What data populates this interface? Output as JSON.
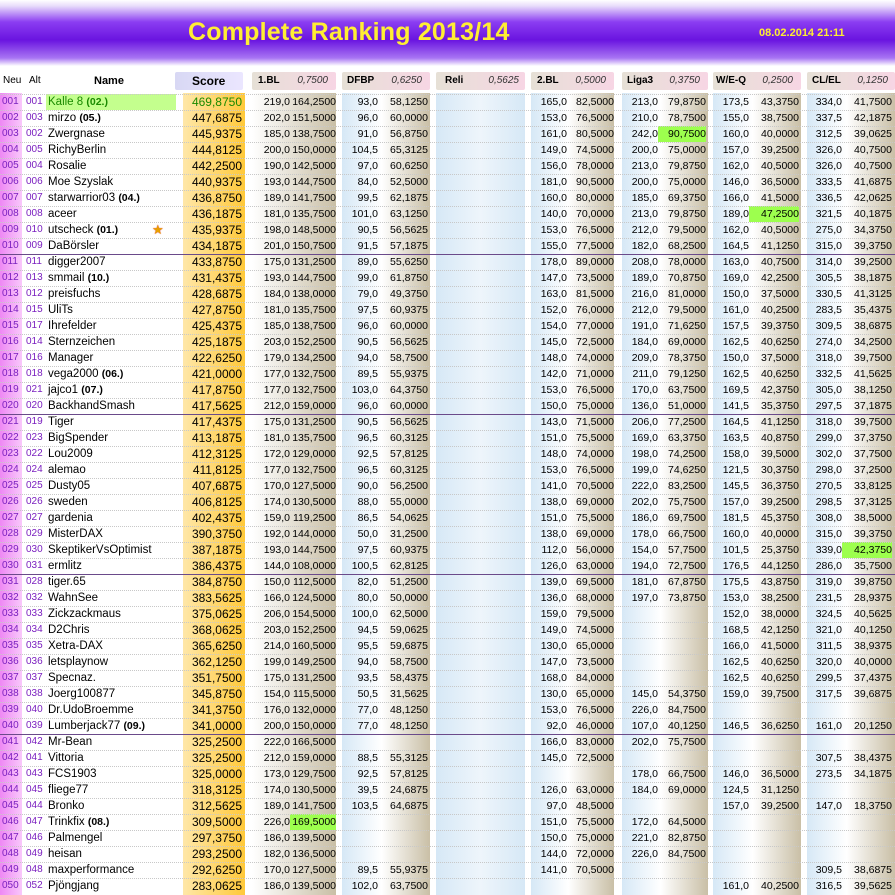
{
  "title": "Complete Ranking 2013/14",
  "date": "08.02.2014 21:11",
  "headers": {
    "neu": "Neu",
    "alt": "Alt",
    "name": "Name",
    "score": "Score",
    "bl1": "1.BL",
    "bl1_w": "0,7500",
    "dfbp": "DFBP",
    "dfbp_w": "0,6250",
    "reli": "Reli",
    "reli_w": "0,5625",
    "bl2": "2.BL",
    "bl2_w": "0,5000",
    "liga3": "Liga3",
    "liga3_w": "0,3750",
    "weq": "W/E-Q",
    "weq_w": "0,2500",
    "clel": "CL/EL",
    "clel_w": "0,1250"
  },
  "colors": {
    "accent": "#8b3df2",
    "title": "#ffee33",
    "rank": "#7a1fbf",
    "highlight": "#9dff4e",
    "leader": "#c4ff8e"
  },
  "rows": [
    {
      "neu": "001",
      "alt": "001",
      "name": "Kalle 8",
      "tag": "(02.)",
      "score": "469,8750",
      "c": [
        "219,0",
        "164,2500",
        "93,0",
        "58,1250",
        "",
        "",
        "165,0",
        "82,5000",
        "213,0",
        "79,8750",
        "173,5",
        "43,3750",
        "334,0",
        "41,7500"
      ]
    },
    {
      "neu": "002",
      "alt": "003",
      "name": "mirzo",
      "tag": "(05.)",
      "score": "447,6875",
      "c": [
        "202,0",
        "151,5000",
        "96,0",
        "60,0000",
        "",
        "",
        "153,0",
        "76,5000",
        "210,0",
        "78,7500",
        "155,0",
        "38,7500",
        "337,5",
        "42,1875"
      ]
    },
    {
      "neu": "003",
      "alt": "002",
      "name": "Zwergnase",
      "tag": "",
      "score": "445,9375",
      "c": [
        "185,0",
        "138,7500",
        "91,0",
        "56,8750",
        "",
        "",
        "161,0",
        "80,5000",
        "242,0",
        "90,7500",
        "160,0",
        "40,0000",
        "312,5",
        "39,0625"
      ]
    },
    {
      "neu": "004",
      "alt": "005",
      "name": "RichyBerlin",
      "tag": "",
      "score": "444,8125",
      "c": [
        "200,0",
        "150,0000",
        "104,5",
        "65,3125",
        "",
        "",
        "149,0",
        "74,5000",
        "200,0",
        "75,0000",
        "157,0",
        "39,2500",
        "326,0",
        "40,7500"
      ]
    },
    {
      "neu": "005",
      "alt": "004",
      "name": "Rosalie",
      "tag": "",
      "score": "442,2500",
      "c": [
        "190,0",
        "142,5000",
        "97,0",
        "60,6250",
        "",
        "",
        "156,0",
        "78,0000",
        "213,0",
        "79,8750",
        "162,0",
        "40,5000",
        "326,0",
        "40,7500"
      ]
    },
    {
      "neu": "006",
      "alt": "006",
      "name": "Moe Szyslak",
      "tag": "",
      "score": "440,9375",
      "c": [
        "193,0",
        "144,7500",
        "84,0",
        "52,5000",
        "",
        "",
        "181,0",
        "90,5000",
        "200,0",
        "75,0000",
        "146,0",
        "36,5000",
        "333,5",
        "41,6875"
      ]
    },
    {
      "neu": "007",
      "alt": "007",
      "name": "starwarrior03",
      "tag": "(04.)",
      "score": "436,8750",
      "c": [
        "189,0",
        "141,7500",
        "99,5",
        "62,1875",
        "",
        "",
        "160,0",
        "80,0000",
        "185,0",
        "69,3750",
        "166,0",
        "41,5000",
        "336,5",
        "42,0625"
      ]
    },
    {
      "neu": "008",
      "alt": "008",
      "name": "aceer",
      "tag": "",
      "score": "436,1875",
      "c": [
        "181,0",
        "135,7500",
        "101,0",
        "63,1250",
        "",
        "",
        "140,0",
        "70,0000",
        "213,0",
        "79,8750",
        "189,0",
        "47,2500",
        "321,5",
        "40,1875"
      ]
    },
    {
      "neu": "009",
      "alt": "010",
      "name": "utscheck",
      "tag": "(01.)",
      "star": "★",
      "score": "435,9375",
      "c": [
        "198,0",
        "148,5000",
        "90,5",
        "56,5625",
        "",
        "",
        "153,0",
        "76,5000",
        "212,0",
        "79,5000",
        "162,0",
        "40,5000",
        "275,0",
        "34,3750"
      ]
    },
    {
      "neu": "010",
      "alt": "009",
      "name": "DaBörsler",
      "tag": "",
      "score": "434,1875",
      "c": [
        "201,0",
        "150,7500",
        "91,5",
        "57,1875",
        "",
        "",
        "155,0",
        "77,5000",
        "182,0",
        "68,2500",
        "164,5",
        "41,1250",
        "315,0",
        "39,3750"
      ]
    },
    {
      "neu": "011",
      "alt": "011",
      "name": "digger2007",
      "tag": "",
      "score": "433,8750",
      "c": [
        "175,0",
        "131,2500",
        "89,0",
        "55,6250",
        "",
        "",
        "178,0",
        "89,0000",
        "208,0",
        "78,0000",
        "163,0",
        "40,7500",
        "314,0",
        "39,2500"
      ]
    },
    {
      "neu": "012",
      "alt": "013",
      "name": "smmail",
      "tag": "(10.)",
      "score": "431,4375",
      "c": [
        "193,0",
        "144,7500",
        "99,0",
        "61,8750",
        "",
        "",
        "147,0",
        "73,5000",
        "189,0",
        "70,8750",
        "169,0",
        "42,2500",
        "305,5",
        "38,1875"
      ]
    },
    {
      "neu": "013",
      "alt": "012",
      "name": "preisfuchs",
      "tag": "",
      "score": "428,6875",
      "c": [
        "184,0",
        "138,0000",
        "79,0",
        "49,3750",
        "",
        "",
        "163,0",
        "81,5000",
        "216,0",
        "81,0000",
        "150,0",
        "37,5000",
        "330,5",
        "41,3125"
      ]
    },
    {
      "neu": "014",
      "alt": "015",
      "name": "UliTs",
      "tag": "",
      "score": "427,8750",
      "c": [
        "181,0",
        "135,7500",
        "97,5",
        "60,9375",
        "",
        "",
        "152,0",
        "76,0000",
        "212,0",
        "79,5000",
        "161,0",
        "40,2500",
        "283,5",
        "35,4375"
      ]
    },
    {
      "neu": "015",
      "alt": "017",
      "name": "Ihrefelder",
      "tag": "",
      "score": "425,4375",
      "c": [
        "185,0",
        "138,7500",
        "96,0",
        "60,0000",
        "",
        "",
        "154,0",
        "77,0000",
        "191,0",
        "71,6250",
        "157,5",
        "39,3750",
        "309,5",
        "38,6875"
      ]
    },
    {
      "neu": "016",
      "alt": "014",
      "name": "Sternzeichen",
      "tag": "",
      "score": "425,1875",
      "c": [
        "203,0",
        "152,2500",
        "90,5",
        "56,5625",
        "",
        "",
        "145,0",
        "72,5000",
        "184,0",
        "69,0000",
        "162,5",
        "40,6250",
        "274,0",
        "34,2500"
      ]
    },
    {
      "neu": "017",
      "alt": "016",
      "name": "Manager",
      "tag": "",
      "score": "422,6250",
      "c": [
        "179,0",
        "134,2500",
        "94,0",
        "58,7500",
        "",
        "",
        "148,0",
        "74,0000",
        "209,0",
        "78,3750",
        "150,0",
        "37,5000",
        "318,0",
        "39,7500"
      ]
    },
    {
      "neu": "018",
      "alt": "018",
      "name": "vega2000",
      "tag": "(06.)",
      "score": "421,0000",
      "c": [
        "177,0",
        "132,7500",
        "89,5",
        "55,9375",
        "",
        "",
        "142,0",
        "71,0000",
        "211,0",
        "79,1250",
        "162,5",
        "40,6250",
        "332,5",
        "41,5625"
      ]
    },
    {
      "neu": "019",
      "alt": "021",
      "name": "jajco1",
      "tag": "(07.)",
      "score": "417,8750",
      "c": [
        "177,0",
        "132,7500",
        "103,0",
        "64,3750",
        "",
        "",
        "153,0",
        "76,5000",
        "170,0",
        "63,7500",
        "169,5",
        "42,3750",
        "305,0",
        "38,1250"
      ]
    },
    {
      "neu": "020",
      "alt": "020",
      "name": "BackhandSmash",
      "tag": "",
      "score": "417,5625",
      "c": [
        "212,0",
        "159,0000",
        "96,0",
        "60,0000",
        "",
        "",
        "150,0",
        "75,0000",
        "136,0",
        "51,0000",
        "141,5",
        "35,3750",
        "297,5",
        "37,1875"
      ]
    },
    {
      "neu": "021",
      "alt": "019",
      "name": "Tiger",
      "tag": "",
      "score": "417,4375",
      "c": [
        "175,0",
        "131,2500",
        "90,5",
        "56,5625",
        "",
        "",
        "143,0",
        "71,5000",
        "206,0",
        "77,2500",
        "164,5",
        "41,1250",
        "318,0",
        "39,7500"
      ]
    },
    {
      "neu": "022",
      "alt": "023",
      "name": "BigSpender",
      "tag": "",
      "score": "413,1875",
      "c": [
        "181,0",
        "135,7500",
        "96,5",
        "60,3125",
        "",
        "",
        "151,0",
        "75,5000",
        "169,0",
        "63,3750",
        "163,5",
        "40,8750",
        "299,0",
        "37,3750"
      ]
    },
    {
      "neu": "023",
      "alt": "022",
      "name": "Lou2009",
      "tag": "",
      "score": "412,3125",
      "c": [
        "172,0",
        "129,0000",
        "92,5",
        "57,8125",
        "",
        "",
        "148,0",
        "74,0000",
        "198,0",
        "74,2500",
        "158,0",
        "39,5000",
        "302,0",
        "37,7500"
      ]
    },
    {
      "neu": "024",
      "alt": "024",
      "name": "alemao",
      "tag": "",
      "score": "411,8125",
      "c": [
        "177,0",
        "132,7500",
        "96,5",
        "60,3125",
        "",
        "",
        "153,0",
        "76,5000",
        "199,0",
        "74,6250",
        "121,5",
        "30,3750",
        "298,0",
        "37,2500"
      ]
    },
    {
      "neu": "025",
      "alt": "025",
      "name": "Dusty05",
      "tag": "",
      "score": "407,6875",
      "c": [
        "170,0",
        "127,5000",
        "90,0",
        "56,2500",
        "",
        "",
        "141,0",
        "70,5000",
        "222,0",
        "83,2500",
        "145,5",
        "36,3750",
        "270,5",
        "33,8125"
      ]
    },
    {
      "neu": "026",
      "alt": "026",
      "name": "sweden",
      "tag": "",
      "score": "406,8125",
      "c": [
        "174,0",
        "130,5000",
        "88,0",
        "55,0000",
        "",
        "",
        "138,0",
        "69,0000",
        "202,0",
        "75,7500",
        "157,0",
        "39,2500",
        "298,5",
        "37,3125"
      ]
    },
    {
      "neu": "027",
      "alt": "027",
      "name": "gardenia",
      "tag": "",
      "score": "402,4375",
      "c": [
        "159,0",
        "119,2500",
        "86,5",
        "54,0625",
        "",
        "",
        "151,0",
        "75,5000",
        "186,0",
        "69,7500",
        "181,5",
        "45,3750",
        "308,0",
        "38,5000"
      ]
    },
    {
      "neu": "028",
      "alt": "029",
      "name": "MisterDAX",
      "tag": "",
      "score": "390,3750",
      "c": [
        "192,0",
        "144,0000",
        "50,0",
        "31,2500",
        "",
        "",
        "138,0",
        "69,0000",
        "178,0",
        "66,7500",
        "160,0",
        "40,0000",
        "315,0",
        "39,3750"
      ]
    },
    {
      "neu": "029",
      "alt": "030",
      "name": "SkeptikerVsOptimist",
      "tag": "",
      "score": "387,1875",
      "c": [
        "193,0",
        "144,7500",
        "97,5",
        "60,9375",
        "",
        "",
        "112,0",
        "56,0000",
        "154,0",
        "57,7500",
        "101,5",
        "25,3750",
        "339,0",
        "42,3750"
      ]
    },
    {
      "neu": "030",
      "alt": "031",
      "name": "ermlitz",
      "tag": "",
      "score": "386,4375",
      "c": [
        "144,0",
        "108,0000",
        "100,5",
        "62,8125",
        "",
        "",
        "126,0",
        "63,0000",
        "194,0",
        "72,7500",
        "176,5",
        "44,1250",
        "286,0",
        "35,7500"
      ]
    },
    {
      "neu": "031",
      "alt": "028",
      "name": "tiger.65",
      "tag": "",
      "score": "384,8750",
      "c": [
        "150,0",
        "112,5000",
        "82,0",
        "51,2500",
        "",
        "",
        "139,0",
        "69,5000",
        "181,0",
        "67,8750",
        "175,5",
        "43,8750",
        "319,0",
        "39,8750"
      ]
    },
    {
      "neu": "032",
      "alt": "032",
      "name": "WahnSee",
      "tag": "",
      "score": "383,5625",
      "c": [
        "166,0",
        "124,5000",
        "80,0",
        "50,0000",
        "",
        "",
        "136,0",
        "68,0000",
        "197,0",
        "73,8750",
        "153,0",
        "38,2500",
        "231,5",
        "28,9375"
      ]
    },
    {
      "neu": "033",
      "alt": "033",
      "name": "Zickzackmaus",
      "tag": "",
      "score": "375,0625",
      "c": [
        "206,0",
        "154,5000",
        "100,0",
        "62,5000",
        "",
        "",
        "159,0",
        "79,5000",
        "",
        "",
        "152,0",
        "38,0000",
        "324,5",
        "40,5625"
      ]
    },
    {
      "neu": "034",
      "alt": "034",
      "name": "D2Chris",
      "tag": "",
      "score": "368,0625",
      "c": [
        "203,0",
        "152,2500",
        "94,5",
        "59,0625",
        "",
        "",
        "149,0",
        "74,5000",
        "",
        "",
        "168,5",
        "42,1250",
        "321,0",
        "40,1250"
      ]
    },
    {
      "neu": "035",
      "alt": "035",
      "name": "Xetra-DAX",
      "tag": "",
      "score": "365,6250",
      "c": [
        "214,0",
        "160,5000",
        "95,5",
        "59,6875",
        "",
        "",
        "130,0",
        "65,0000",
        "",
        "",
        "166,0",
        "41,5000",
        "311,5",
        "38,9375"
      ]
    },
    {
      "neu": "036",
      "alt": "036",
      "name": "letsplaynow",
      "tag": "",
      "score": "362,1250",
      "c": [
        "199,0",
        "149,2500",
        "94,0",
        "58,7500",
        "",
        "",
        "147,0",
        "73,5000",
        "",
        "",
        "162,5",
        "40,6250",
        "320,0",
        "40,0000"
      ]
    },
    {
      "neu": "037",
      "alt": "037",
      "name": "Specnaz.",
      "tag": "",
      "score": "351,7500",
      "c": [
        "175,0",
        "131,2500",
        "93,5",
        "58,4375",
        "",
        "",
        "168,0",
        "84,0000",
        "",
        "",
        "162,5",
        "40,6250",
        "299,5",
        "37,4375"
      ]
    },
    {
      "neu": "038",
      "alt": "038",
      "name": "Joerg100877",
      "tag": "",
      "score": "345,8750",
      "c": [
        "154,0",
        "115,5000",
        "50,5",
        "31,5625",
        "",
        "",
        "130,0",
        "65,0000",
        "145,0",
        "54,3750",
        "159,0",
        "39,7500",
        "317,5",
        "39,6875"
      ]
    },
    {
      "neu": "039",
      "alt": "040",
      "name": "Dr.UdoBroemme",
      "tag": "",
      "score": "341,3750",
      "c": [
        "176,0",
        "132,0000",
        "77,0",
        "48,1250",
        "",
        "",
        "153,0",
        "76,5000",
        "226,0",
        "84,7500",
        "",
        "",
        "",
        ""
      ]
    },
    {
      "neu": "040",
      "alt": "039",
      "name": "Lumberjack77",
      "tag": "(09.)",
      "score": "341,0000",
      "c": [
        "200,0",
        "150,0000",
        "77,0",
        "48,1250",
        "",
        "",
        "92,0",
        "46,0000",
        "107,0",
        "40,1250",
        "146,5",
        "36,6250",
        "161,0",
        "20,1250"
      ]
    },
    {
      "neu": "041",
      "alt": "042",
      "name": "Mr-Bean",
      "tag": "",
      "score": "325,2500",
      "c": [
        "222,0",
        "166,5000",
        "",
        "",
        "",
        "",
        "166,0",
        "83,0000",
        "202,0",
        "75,7500",
        "",
        "",
        "",
        ""
      ]
    },
    {
      "neu": "042",
      "alt": "041",
      "name": "Vittoria",
      "tag": "",
      "score": "325,2500",
      "c": [
        "212,0",
        "159,0000",
        "88,5",
        "55,3125",
        "",
        "",
        "145,0",
        "72,5000",
        "",
        "",
        "",
        "",
        "307,5",
        "38,4375"
      ]
    },
    {
      "neu": "043",
      "alt": "043",
      "name": "FCS1903",
      "tag": "",
      "score": "325,0000",
      "c": [
        "173,0",
        "129,7500",
        "92,5",
        "57,8125",
        "",
        "",
        "",
        "",
        "178,0",
        "66,7500",
        "146,0",
        "36,5000",
        "273,5",
        "34,1875"
      ]
    },
    {
      "neu": "044",
      "alt": "045",
      "name": "fliege77",
      "tag": "",
      "score": "318,3125",
      "c": [
        "174,0",
        "130,5000",
        "39,5",
        "24,6875",
        "",
        "",
        "126,0",
        "63,0000",
        "184,0",
        "69,0000",
        "124,5",
        "31,1250",
        "",
        ""
      ]
    },
    {
      "neu": "045",
      "alt": "044",
      "name": "Bronko",
      "tag": "",
      "score": "312,5625",
      "c": [
        "189,0",
        "141,7500",
        "103,5",
        "64,6875",
        "",
        "",
        "97,0",
        "48,5000",
        "",
        "",
        "157,0",
        "39,2500",
        "147,0",
        "18,3750"
      ]
    },
    {
      "neu": "046",
      "alt": "047",
      "name": "Trinkfix",
      "tag": "(08.)",
      "score": "309,5000",
      "c": [
        "226,0",
        "169,5000",
        "",
        "",
        "",
        "",
        "151,0",
        "75,5000",
        "172,0",
        "64,5000",
        "",
        "",
        "",
        ""
      ]
    },
    {
      "neu": "047",
      "alt": "046",
      "name": "Palmengel",
      "tag": "",
      "score": "297,3750",
      "c": [
        "186,0",
        "139,5000",
        "",
        "",
        "",
        "",
        "150,0",
        "75,0000",
        "221,0",
        "82,8750",
        "",
        "",
        "",
        ""
      ]
    },
    {
      "neu": "048",
      "alt": "049",
      "name": "heisan",
      "tag": "",
      "score": "293,2500",
      "c": [
        "182,0",
        "136,5000",
        "",
        "",
        "",
        "",
        "144,0",
        "72,0000",
        "226,0",
        "84,7500",
        "",
        "",
        "",
        ""
      ]
    },
    {
      "neu": "049",
      "alt": "048",
      "name": "maxperformance",
      "tag": "",
      "score": "292,6250",
      "c": [
        "170,0",
        "127,5000",
        "89,5",
        "55,9375",
        "",
        "",
        "141,0",
        "70,5000",
        "",
        "",
        "",
        "",
        "309,5",
        "38,6875"
      ]
    },
    {
      "neu": "050",
      "alt": "052",
      "name": "Pjöngjang",
      "tag": "",
      "score": "283,0625",
      "c": [
        "186,0",
        "139,5000",
        "102,0",
        "63,7500",
        "",
        "",
        "",
        "",
        "",
        "",
        "161,0",
        "40,2500",
        "316,5",
        "39,5625"
      ]
    }
  ],
  "highlights": [
    [
      2,
      9
    ],
    [
      7,
      11
    ],
    [
      28,
      13
    ],
    [
      45,
      1
    ]
  ]
}
